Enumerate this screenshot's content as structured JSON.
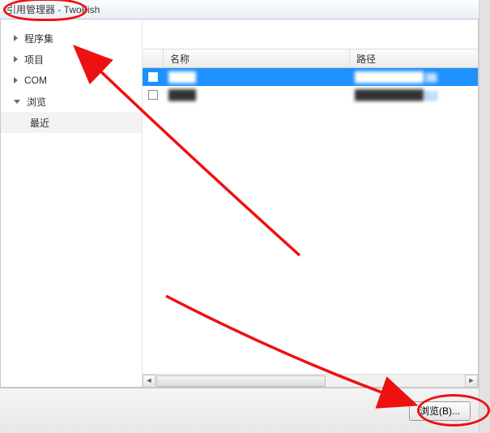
{
  "title": "引用管理器 - TwoFish",
  "sidebar": {
    "items": [
      {
        "label": "程序集",
        "expanded": false
      },
      {
        "label": "项目",
        "expanded": false
      },
      {
        "label": "COM",
        "expanded": false
      },
      {
        "label": "浏览",
        "expanded": true,
        "children": [
          {
            "label": "最近"
          }
        ]
      }
    ]
  },
  "grid": {
    "columns": {
      "name": "名称",
      "path": "路径"
    },
    "rows": [
      {
        "selected": true,
        "name": "████",
        "path": "██████████",
        "suffix": "项"
      },
      {
        "selected": false,
        "name": "████",
        "path": "██████████",
        "suffix": "项"
      }
    ]
  },
  "footer": {
    "browse_label": "浏览(B)..."
  },
  "annotation": {
    "arrows_color": "#e11111"
  }
}
